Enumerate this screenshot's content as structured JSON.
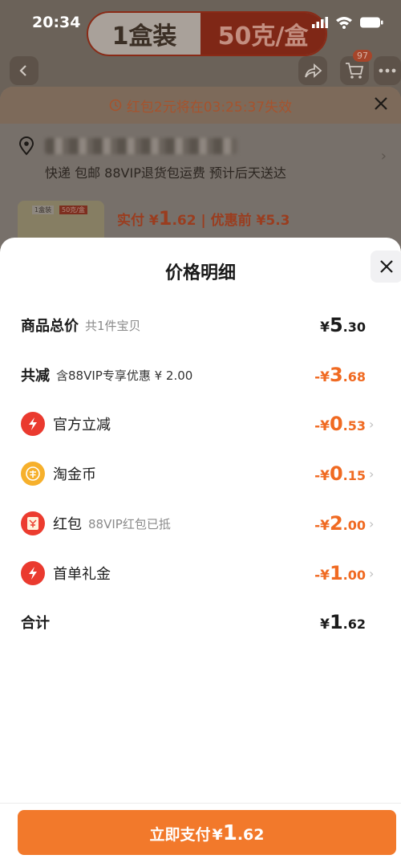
{
  "status": {
    "time": "20:34"
  },
  "spec_selector": {
    "left": "1盒装",
    "right": "50克/盒"
  },
  "nav": {
    "cart_badge": "97"
  },
  "order": {
    "redpack_notice": "红包2元将在03:25:37失效",
    "delivery": "快递 包邮 88VIP退货包运费 预计后天送达",
    "thumb_tag_1": "1盒装",
    "thumb_tag_2": "50克/盒",
    "paid_label": "实付 ¥",
    "paid_int": "1",
    "paid_dec": ".62",
    "before_discount": " | 优惠前 ¥5.3"
  },
  "panel": {
    "title": "价格明细",
    "rows": [
      {
        "label": "商品总价",
        "sub": "共1件宝贝",
        "pre": "¥",
        "int": "5",
        "dec": ".30"
      },
      {
        "label": "共减",
        "sub": "含88VIP专享优惠 ¥ 2.00",
        "pre": "-¥",
        "int": "3",
        "dec": ".68"
      },
      {
        "label": "官方立减",
        "sub": "",
        "pre": "-¥",
        "int": "0",
        "dec": ".53"
      },
      {
        "label": "淘金币",
        "sub": "",
        "pre": "-¥",
        "int": "0",
        "dec": ".15"
      },
      {
        "label": "红包",
        "sub": "88VIP红包已抵",
        "pre": "-¥",
        "int": "2",
        "dec": ".00"
      },
      {
        "label": "首单礼金",
        "sub": "",
        "pre": "-¥",
        "int": "1",
        "dec": ".00"
      },
      {
        "label": "合计",
        "sub": "",
        "pre": "¥",
        "int": "1",
        "dec": ".62"
      }
    ]
  },
  "pay_button": {
    "label": "立即支付",
    "yen": "¥",
    "int": "1",
    "dec": ".62"
  },
  "colors": {
    "accent": "#f2792b",
    "discount": "#f06a22"
  }
}
